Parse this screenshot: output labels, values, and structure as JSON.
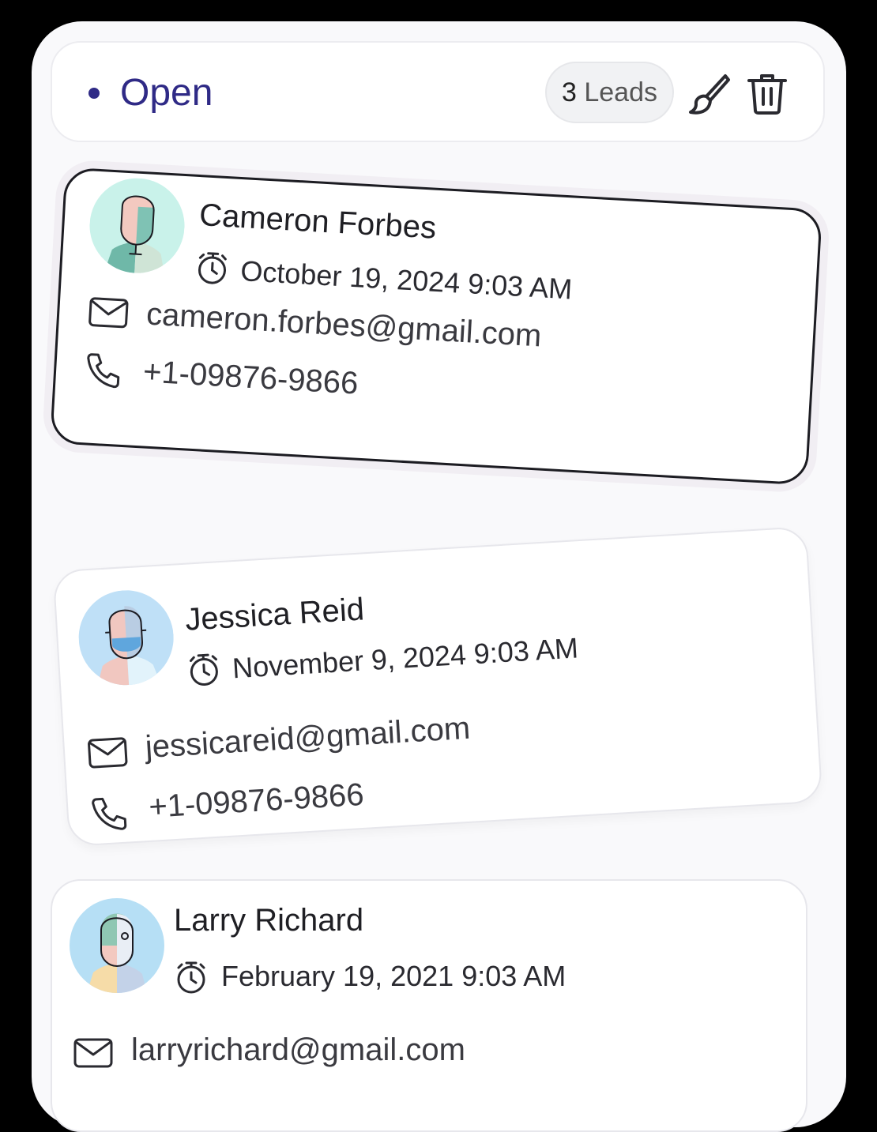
{
  "header": {
    "status_label": "Open",
    "leads_count": "3",
    "leads_label": "Leads",
    "edit_icon": "paintbrush-icon",
    "delete_icon": "trash-icon"
  },
  "leads": [
    {
      "name": "Cameron Forbes",
      "date": "October 19, 2024 9:03 AM",
      "email": "cameron.forbes@gmail.com",
      "phone": "+1-09876-9866"
    },
    {
      "name": "Jessica Reid",
      "date": "November 9, 2024 9:03 AM",
      "email": "jessicareid@gmail.com",
      "phone": "+1-09876-9866"
    },
    {
      "name": "Larry Richard",
      "date": "February 19, 2021 9:03 AM",
      "email": "larryrichard@gmail.com"
    }
  ],
  "colors": {
    "accent": "#2f2a86",
    "panel": "#f9f9fb",
    "card_border_active": "#1c1c22"
  }
}
